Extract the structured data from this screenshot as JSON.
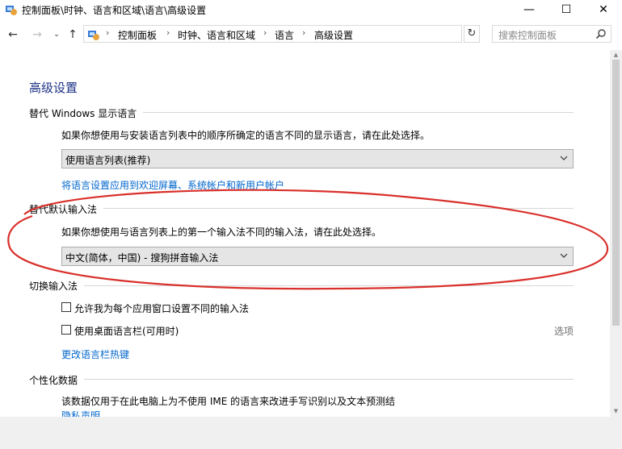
{
  "window": {
    "title": "控制面板\\时钟、语言和区域\\语言\\高级设置",
    "minimize": "—",
    "maximize": "☐",
    "close": "✕"
  },
  "address_bar": {
    "crumbs": [
      "控制面板",
      "时钟、语言和区域",
      "语言",
      "高级设置"
    ],
    "search_placeholder": "搜索控制面板"
  },
  "page": {
    "title": "高级设置",
    "display_language": {
      "heading": "替代 Windows 显示语言",
      "description": "如果你想使用与安装语言列表中的顺序所确定的语言不同的显示语言，请在此处选择。",
      "selected": "使用语言列表(推荐)",
      "apply_link": "将语言设置应用到欢迎屏幕、系统帐户和新用户帐户"
    },
    "input_method": {
      "heading": "替代默认输入法",
      "description": "如果你想使用与语言列表上的第一个输入法不同的输入法，请在此处选择。",
      "selected": "中文(简体，中国) - 搜狗拼音输入法"
    },
    "switch_input": {
      "heading": "切换输入法",
      "per_app_label": "允许我为每个应用窗口设置不同的输入法",
      "per_app_checked": false,
      "language_bar_label": "使用桌面语言栏(可用时)",
      "language_bar_checked": false,
      "options_link": "选项",
      "hotkeys_link": "更改语言栏热键"
    },
    "personalization": {
      "heading": "个性化数据",
      "description": "该数据仅用于在此电脑上为不使用 IME 的语言来改进手写识别以及文本预测结",
      "privacy_link": "隐私声明"
    }
  },
  "colors": {
    "title_blue": "#1e3287",
    "link_blue": "#0066cc",
    "annotation_red": "#d9302b"
  }
}
